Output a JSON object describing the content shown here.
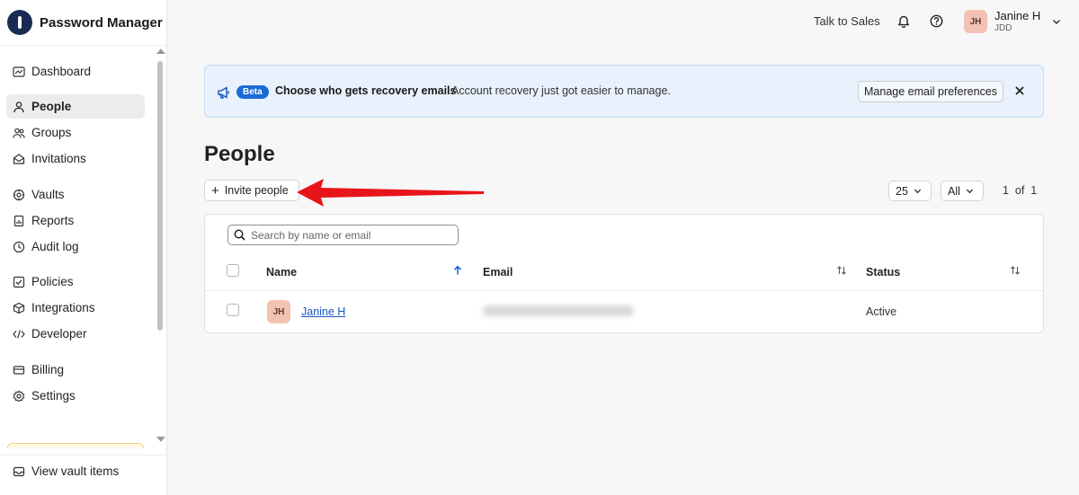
{
  "app": {
    "name": "Password Manager"
  },
  "sidebar": {
    "items": [
      {
        "label": "Dashboard",
        "icon": "dashboard-icon",
        "active": false
      },
      {
        "label": "People",
        "icon": "person-icon",
        "active": true
      },
      {
        "label": "Groups",
        "icon": "group-icon",
        "active": false
      },
      {
        "label": "Invitations",
        "icon": "envelope-icon",
        "active": false
      },
      {
        "label": "Vaults",
        "icon": "vault-icon",
        "active": false
      },
      {
        "label": "Reports",
        "icon": "report-icon",
        "active": false
      },
      {
        "label": "Audit log",
        "icon": "history-icon",
        "active": false
      },
      {
        "label": "Policies",
        "icon": "checklist-icon",
        "active": false
      },
      {
        "label": "Integrations",
        "icon": "cube-icon",
        "active": false
      },
      {
        "label": "Developer",
        "icon": "code-icon",
        "active": false
      },
      {
        "label": "Billing",
        "icon": "card-icon",
        "active": false
      },
      {
        "label": "Settings",
        "icon": "gear-icon",
        "active": false
      }
    ],
    "footer_item": {
      "label": "View vault items",
      "icon": "tray-icon"
    }
  },
  "topbar": {
    "talk_to_sales": "Talk to Sales",
    "bell_icon": "bell-icon",
    "help_icon": "help-icon",
    "user": {
      "initials": "JH",
      "name": "Janine H",
      "org": "JDD"
    }
  },
  "banner": {
    "badge": "Beta",
    "title": "Choose who gets recovery emails",
    "text": "Account recovery just got easier to manage.",
    "button": "Manage email preferences"
  },
  "page": {
    "title": "People",
    "invite_button": "Invite people",
    "page_size": "25",
    "filter": "All",
    "pager": "1  of  1"
  },
  "table": {
    "search_placeholder": "Search by name or email",
    "columns": [
      "Name",
      "Email",
      "Status"
    ],
    "rows": [
      {
        "initials": "JH",
        "name": "Janine H",
        "email": "",
        "status": "Active"
      }
    ]
  },
  "colors": {
    "accent": "#1a6ad6",
    "annotation_arrow": "#e8141b",
    "avatar": "#f2c3b3",
    "banner_bg": "#e8f1fc"
  }
}
